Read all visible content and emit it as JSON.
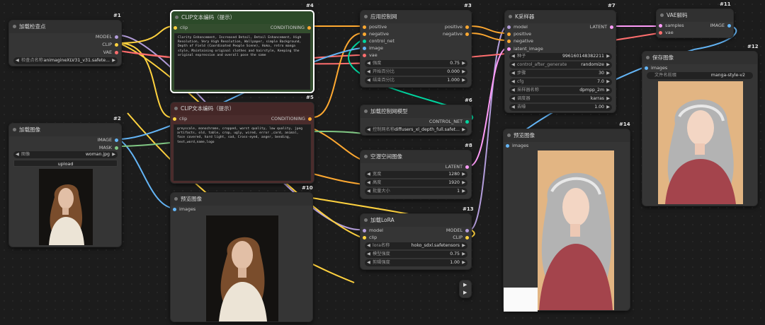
{
  "nodes": {
    "n1": {
      "id": "#1",
      "title": "加载检查点",
      "outputs": [
        "MODEL",
        "CLIP",
        "VAE"
      ],
      "ckpt_label": "检查点名称",
      "ckpt_value": "animagineXLV31_v31.safete..."
    },
    "n2": {
      "id": "#2",
      "title": "加载图像",
      "outputs": [
        "IMAGE",
        "MASK"
      ],
      "image_label": "图像",
      "image_value": "woman.jpg",
      "upload": "upload"
    },
    "n4": {
      "id": "#4",
      "title": "CLIP文本编码（提示）",
      "input": "clip",
      "output": "CONDITIONING",
      "text": "Clarity Enhancement, Increased Detail, Detail Enhancement, High Resolution, Very High Resolution, Wallpaper, simple Background, Depth of Field (Coordinated People Scene), Hoko, retro manga style, Maintaining original clothes and hairstyle, Keeping the original expression and overall pose the same"
    },
    "n5": {
      "id": "#5",
      "title": "CLIP文本编码（提示）",
      "input": "clip",
      "output": "CONDITIONING",
      "text": "greyscale, monochrome, cropped, worst quality, low quality, jpeg artifacts, old, table, crop, ugly, wired, error ,card, animal, face covered, hard light, sad, Cross-eyed, anger, bending, text,word,name,logo"
    },
    "n3": {
      "id": "#3",
      "title": "应用控制网",
      "inputs": [
        "positive",
        "negative",
        "control_net",
        "image",
        "vae"
      ],
      "outputs": [
        "positive",
        "negative"
      ],
      "widgets": [
        {
          "label": "强度",
          "value": "0.75"
        },
        {
          "label": "开始百分比",
          "value": "0.000"
        },
        {
          "label": "结束百分比",
          "value": "1.000"
        }
      ]
    },
    "n6": {
      "id": "#6",
      "title": "加载控制网模型",
      "output": "CONTROL_NET",
      "w_label": "控制网名称",
      "w_value": "diffusers_xl_depth_full.safet..."
    },
    "n8": {
      "id": "#8",
      "title": "空潜空间图像",
      "output": "LATENT",
      "widgets": [
        {
          "label": "宽度",
          "value": "1280"
        },
        {
          "label": "高度",
          "value": "1920"
        },
        {
          "label": "批量大小",
          "value": "1"
        }
      ]
    },
    "n13": {
      "id": "#13",
      "title": "加载LoRA",
      "inputs": [
        "model",
        "clip"
      ],
      "outputs": [
        "MODEL",
        "CLIP"
      ],
      "widgets": [
        {
          "label": "lora名称",
          "value": "hoko_sdxl.safetensors"
        },
        {
          "label": "模型强度",
          "value": "0.75"
        },
        {
          "label": "剪辑强度",
          "value": "1.00"
        }
      ]
    },
    "n7": {
      "id": "#7",
      "title": "K采样器",
      "inputs": [
        "model",
        "positive",
        "negative",
        "latent_image"
      ],
      "output": "LATENT",
      "widgets": [
        {
          "label": "种子",
          "value": "996160148382211"
        },
        {
          "label": "control_after_generate",
          "value": "randomize"
        },
        {
          "label": "步骤",
          "value": "30"
        },
        {
          "label": "cfg",
          "value": "7.0"
        },
        {
          "label": "采样器名称",
          "value": "dpmpp_2m"
        },
        {
          "label": "调度器",
          "value": "karras"
        },
        {
          "label": "去噪",
          "value": "1.00"
        }
      ]
    },
    "n11": {
      "id": "#11",
      "title": "VAE解码",
      "inputs": [
        "samples",
        "vae"
      ],
      "output": "IMAGE"
    },
    "n12": {
      "id": "#12",
      "title": "保存图像",
      "input": "images",
      "w_label": "文件名前缀",
      "w_value": "manga-style-v2"
    },
    "n10": {
      "id": "#10",
      "title": "预览图像",
      "input": "images"
    },
    "n14": {
      "id": "#14",
      "title": "预览图像",
      "input": "images"
    }
  },
  "colors": {
    "model": "#b39ddb",
    "clip": "#ffd23f",
    "vae": "#ff6e6e",
    "conditioning": "#ffa931",
    "image": "#64b5f6",
    "latent": "#ff9cf9",
    "control_net": "#00d6a0",
    "mask": "#81c784"
  }
}
